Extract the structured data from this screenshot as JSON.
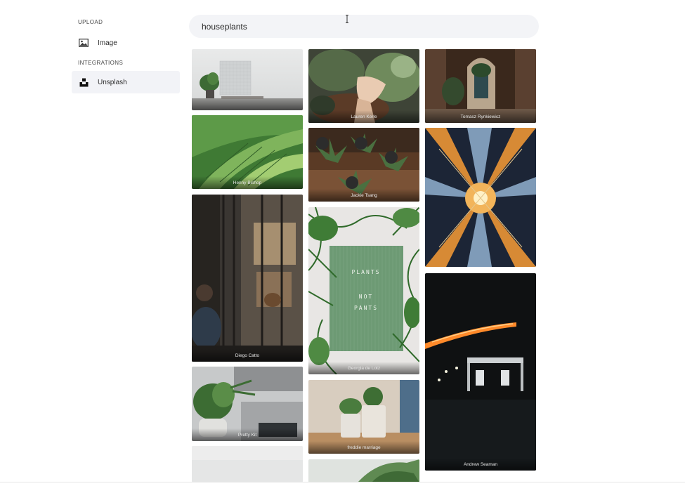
{
  "sidebar": {
    "upload_label": "UPLOAD",
    "image_label": "Image",
    "integrations_label": "INTEGRATIONS",
    "unsplash_label": "Unsplash"
  },
  "search": {
    "value": "houseplants"
  },
  "photos": [
    {
      "credit": ""
    },
    {
      "credit": "Lauren Kerle"
    },
    {
      "credit": "Tomasz Rynkiewicz"
    },
    {
      "credit": "Henny Bishop"
    },
    {
      "credit": "Jackie Tsang"
    },
    {
      "credit": ""
    },
    {
      "credit": "Diego Catto"
    },
    {
      "credit": "Georgia de Lotz"
    },
    {
      "credit": "Andrew Seaman"
    },
    {
      "credit": "Pretty Kit"
    },
    {
      "credit": "freddie marriage"
    },
    {
      "credit": ""
    },
    {
      "credit": ""
    }
  ],
  "poster": {
    "line1": "PLANTS",
    "line2": "NOT",
    "line3": "PANTS"
  },
  "icons": {
    "image": "image-icon",
    "unsplash": "unsplash-logo-icon",
    "cursor": "text-cursor-icon"
  }
}
